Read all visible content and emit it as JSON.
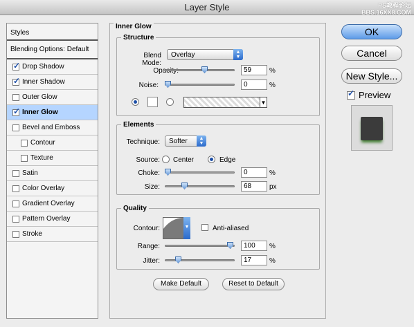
{
  "window": {
    "title": "Layer Style",
    "watermark_line1": "PS教程论坛",
    "watermark_line2": "BBS.16XX8.COM"
  },
  "left_panel": {
    "styles_label": "Styles",
    "blending_label": "Blending Options: Default",
    "items": [
      {
        "label": "Drop Shadow",
        "checked": true
      },
      {
        "label": "Inner Shadow",
        "checked": true
      },
      {
        "label": "Outer Glow",
        "checked": false
      },
      {
        "label": "Inner Glow",
        "checked": true,
        "selected": true
      },
      {
        "label": "Bevel and Emboss",
        "checked": false
      },
      {
        "label": "Contour",
        "checked": false,
        "indent": true
      },
      {
        "label": "Texture",
        "checked": false,
        "indent": true
      },
      {
        "label": "Satin",
        "checked": false
      },
      {
        "label": "Color Overlay",
        "checked": false
      },
      {
        "label": "Gradient Overlay",
        "checked": false
      },
      {
        "label": "Pattern Overlay",
        "checked": false
      },
      {
        "label": "Stroke",
        "checked": false
      }
    ]
  },
  "inner_glow": {
    "title": "Inner Glow",
    "structure": {
      "title": "Structure",
      "blend_mode_label": "Blend Mode:",
      "blend_mode_value": "Overlay",
      "opacity_label": "Opacity:",
      "opacity_value": "59",
      "opacity_unit": "%",
      "noise_label": "Noise:",
      "noise_value": "0",
      "noise_unit": "%",
      "color_choice": "solid"
    },
    "elements": {
      "title": "Elements",
      "technique_label": "Technique:",
      "technique_value": "Softer",
      "source_label": "Source:",
      "source_center": "Center",
      "source_edge": "Edge",
      "source_selected": "Edge",
      "choke_label": "Choke:",
      "choke_value": "0",
      "choke_unit": "%",
      "size_label": "Size:",
      "size_value": "68",
      "size_unit": "px"
    },
    "quality": {
      "title": "Quality",
      "contour_label": "Contour:",
      "anti_aliased_label": "Anti-aliased",
      "anti_aliased": false,
      "range_label": "Range:",
      "range_value": "100",
      "range_unit": "%",
      "jitter_label": "Jitter:",
      "jitter_value": "17",
      "jitter_unit": "%"
    },
    "make_default": "Make Default",
    "reset_default": "Reset to Default"
  },
  "buttons": {
    "ok": "OK",
    "cancel": "Cancel",
    "new_style": "New Style...",
    "preview_label": "Preview",
    "preview_checked": true
  },
  "colors": {
    "selection": "#b5d5ff",
    "accent": "#3a7be0",
    "glow": "#3e7a2e"
  }
}
